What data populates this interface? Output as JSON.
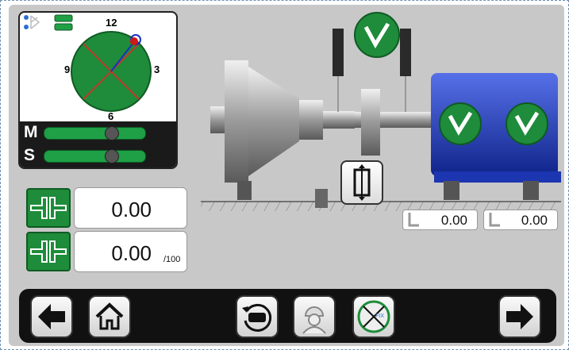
{
  "compass": {
    "labels": {
      "top": "12",
      "right": "3",
      "bottom": "6",
      "left": "9"
    }
  },
  "bars": [
    {
      "letter": "M",
      "level": 0.7
    },
    {
      "letter": "S",
      "level": 0.7
    }
  ],
  "measurements": [
    {
      "value": "0.00",
      "unit": ""
    },
    {
      "value": "0.00",
      "unit": "/100"
    }
  ],
  "feet": [
    {
      "value": "0.00"
    },
    {
      "value": "0.00"
    }
  ],
  "colors": {
    "accent_green": "#1e8c3a",
    "motor_blue": "#1f3fbf",
    "toolbar": "#111111"
  },
  "icons": [
    "bluetooth-icon",
    "battery-icon",
    "coupling-icon",
    "check-icon",
    "sensor-icon",
    "back-arrow-icon",
    "home-icon",
    "rotate-machine-icon",
    "operator-icon",
    "fixed-clock-icon",
    "forward-arrow-icon"
  ]
}
